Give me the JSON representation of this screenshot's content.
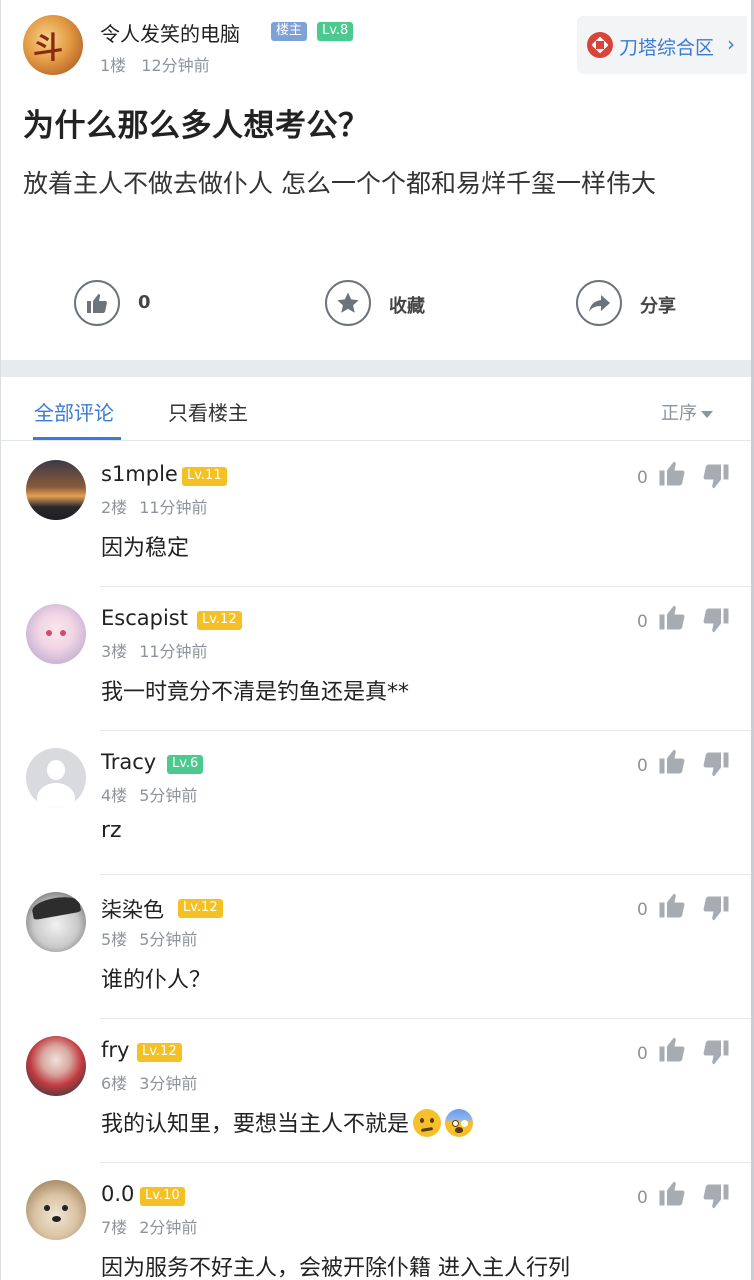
{
  "post": {
    "author": "令人发笑的电脑",
    "owner_badge": "楼主",
    "level": "Lv.8",
    "floor": "1楼",
    "time": "12分钟前",
    "forum": "刀塔综合区",
    "forum_chevron": "›",
    "title": "为什么那么多人想考公？",
    "body": "放着主人不做去做仆人 怎么一个个都和易烊千玺一样伟大"
  },
  "actions": {
    "like_count": "0",
    "favorite_label": "收藏",
    "share_label": "分享"
  },
  "tabs": {
    "all_comments": "全部评论",
    "op_only": "只看楼主",
    "sort": "正序"
  },
  "comments": [
    {
      "name": "s1mple",
      "level": "Lv.11",
      "floor": "2楼",
      "time": "11分钟前",
      "text": "因为稳定",
      "likes": "0"
    },
    {
      "name": "Escapist",
      "level": "Lv.12",
      "floor": "3楼",
      "time": "11分钟前",
      "text": "我一时竟分不清是钓鱼还是真**",
      "likes": "0"
    },
    {
      "name": "Tracy",
      "level": "Lv.6",
      "floor": "4楼",
      "time": "5分钟前",
      "text": "rz",
      "likes": "0"
    },
    {
      "name": "柒染色",
      "level": "Lv.12",
      "floor": "5楼",
      "time": "5分钟前",
      "text": "谁的仆人？",
      "likes": "0"
    },
    {
      "name": "fry",
      "level": "Lv.12",
      "floor": "6楼",
      "time": "3分钟前",
      "text": "我的认知里，要想当主人不就是",
      "likes": "0"
    },
    {
      "name": "0.0",
      "level": "Lv.10",
      "floor": "7楼",
      "time": "2分钟前",
      "text": "因为服务不好主人，会被开除仆籍 进入主人行列",
      "likes": "0"
    }
  ],
  "colors": {
    "accent_blue": "#3a7bd5",
    "level_yellow": "#f5c024",
    "level_green": "#4cc98e",
    "owner_badge": "#7ea2d6",
    "muted_text": "#8e949c"
  },
  "icons": {
    "like": "thumbs-up-icon",
    "favorite": "star-icon",
    "share": "share-arrow-icon",
    "comment_up": "thumbs-up-icon",
    "comment_down": "thumbs-down-icon",
    "forum": "dota-logo-icon",
    "sort": "caret-down-icon"
  }
}
